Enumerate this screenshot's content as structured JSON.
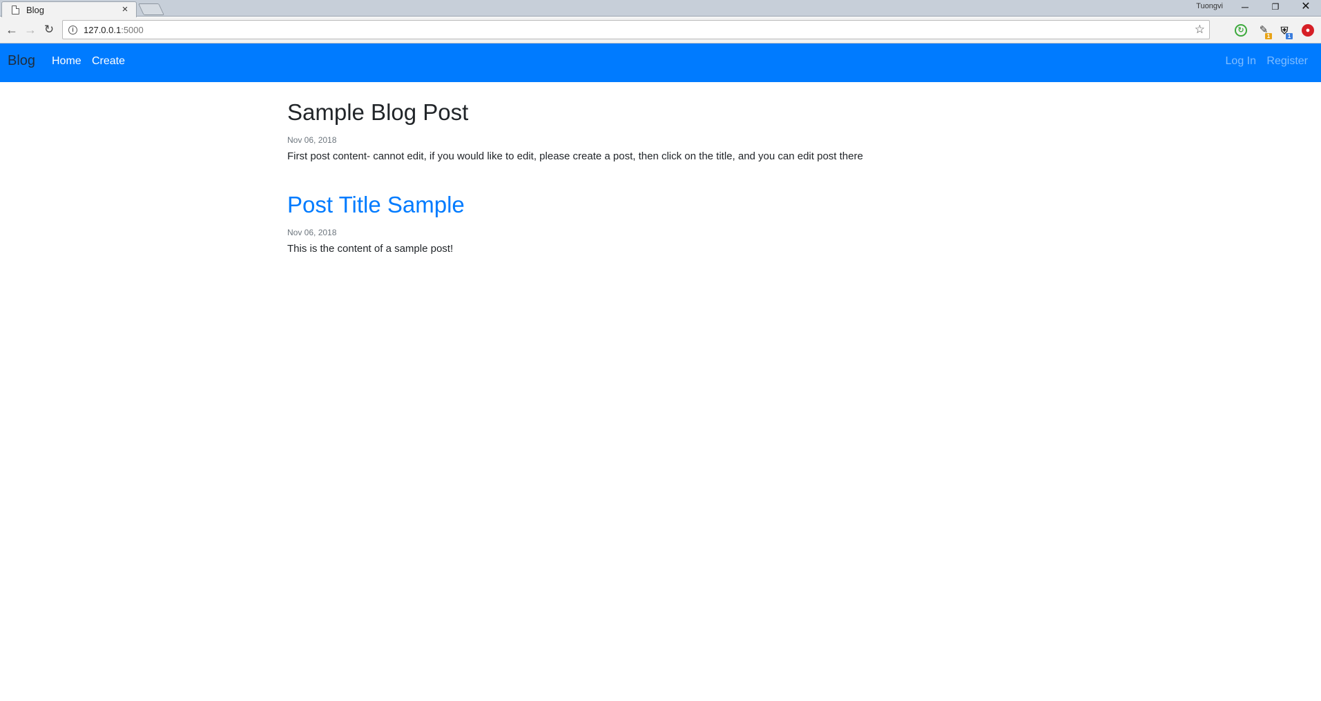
{
  "browser": {
    "tab_title": "Blog",
    "tab_close": "×",
    "profile_name": "Tuongvi",
    "url_host": "127.0.0.1",
    "url_port": ":5000",
    "win_min": "─",
    "win_max": "❐",
    "win_close": "✕",
    "ext_badge_1": "1",
    "ext_badge_2": "1"
  },
  "navbar": {
    "brand": "Blog",
    "links": [
      "Home",
      "Create"
    ],
    "right_links": [
      "Log In",
      "Register"
    ],
    "color": "#007bff"
  },
  "posts": [
    {
      "title": "Sample Blog Post",
      "date": "Nov 06, 2018",
      "body": "First post content- cannot edit, if you would like to edit, please create a post, then click on the title, and you can edit post there"
    },
    {
      "title": "Post Title Sample",
      "date": "Nov 06, 2018",
      "body": "This is the content of a sample post!"
    }
  ]
}
